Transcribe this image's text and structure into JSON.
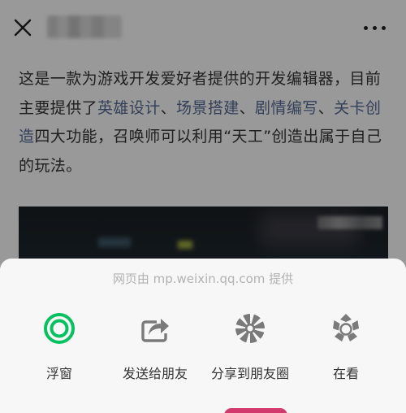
{
  "article": {
    "paragraph_start": "这是一款为游戏开发爱好者提供的开发编辑器，目前主要提供了",
    "features": [
      "英雄设计",
      "场景搭建",
      "剧情编写",
      "关卡创造"
    ],
    "separator": "、",
    "paragraph_end": "四大功能，召唤师可以利用“天工”创造出属于自己的玩法。"
  },
  "share_sheet": {
    "source_text": "网页由 mp.weixin.qq.com 提供",
    "actions": [
      {
        "label": "浮窗",
        "icon": "floating-window-icon"
      },
      {
        "label": "发送给朋友",
        "icon": "send-to-friend-icon"
      },
      {
        "label": "分享到朋友圈",
        "icon": "moments-icon"
      },
      {
        "label": "在看",
        "icon": "wow-icon"
      }
    ]
  },
  "colors": {
    "link": "#576b95",
    "floating_window_green": "#07c160",
    "icon_gray": "#7a7a7a"
  }
}
